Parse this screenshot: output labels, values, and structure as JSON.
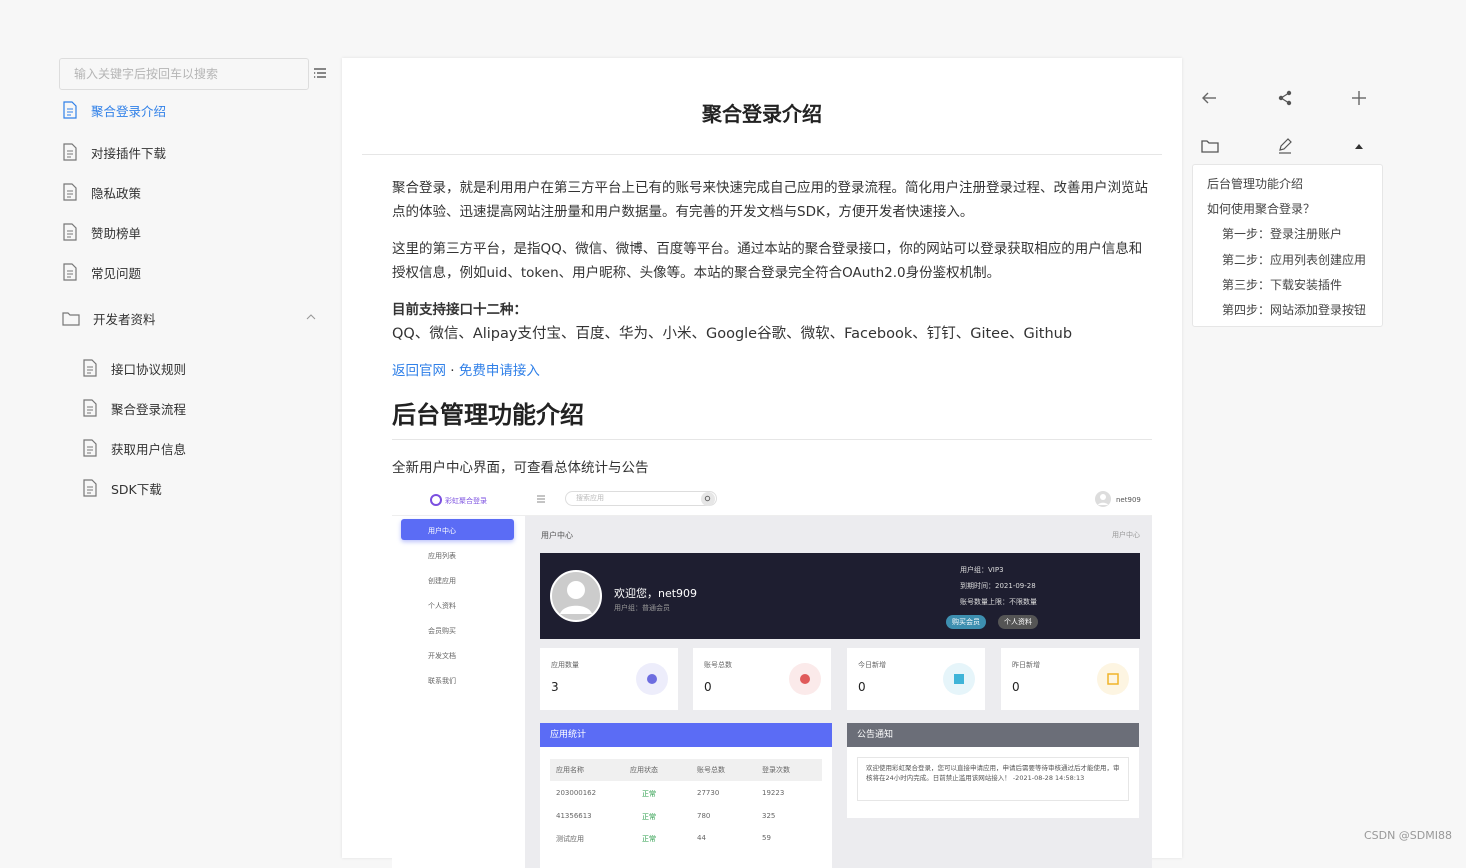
{
  "search": {
    "placeholder": "输入关键字后按回车以搜索"
  },
  "sidebar": {
    "items": [
      {
        "label": "聚合登录介绍"
      },
      {
        "label": "对接插件下载"
      },
      {
        "label": "隐私政策"
      },
      {
        "label": "赞助榜单"
      },
      {
        "label": "常见问题"
      }
    ],
    "folder": {
      "label": "开发者资料"
    },
    "sub_items": [
      {
        "label": "接口协议规则"
      },
      {
        "label": "聚合登录流程"
      },
      {
        "label": "获取用户信息"
      },
      {
        "label": "SDK下载"
      }
    ]
  },
  "doc": {
    "title": "聚合登录介绍",
    "p1": "聚合登录，就是利用用户在第三方平台上已有的账号来快速完成自己应用的登录流程。简化用户注册登录过程、改善用户浏览站点的体验、迅速提高网站注册量和用户数据量。有完善的开发文档与SDK，方便开发者快速接入。",
    "p2": "这里的第三方平台，是指QQ、微信、微博、百度等平台。通过本站的聚合登录接口，你的网站可以登录获取相应的用户信息和授权信息，例如uid、token、用户昵称、头像等。本站的聚合登录完全符合OAuth2.0身份鉴权机制。",
    "support_title": "目前支持接口十二种：",
    "support_list": "QQ、微信、Alipay支付宝、百度、华为、小米、Google谷歌、微软、Facebook、钉钉、Gitee、Github",
    "link_home": "返回官网",
    "link_sep": " · ",
    "link_apply": "免费申请接入",
    "h2": "后台管理功能介绍",
    "p3": "全新用户中心界面，可查看总体统计与公告"
  },
  "screenshot": {
    "brand": "彩虹聚合登录",
    "search_placeholder": "搜索应用",
    "username": "net909",
    "menu": [
      "用户中心",
      "应用列表",
      "创建应用",
      "个人资料",
      "会员购买",
      "开发文档",
      "联系我们"
    ],
    "breadcrumb_title": "用户中心",
    "breadcrumb_right": "用户中心",
    "welcome": "欢迎您，net909",
    "user_group_sub": "用户组：普通会员",
    "info": [
      "用户组：VIP3",
      "到期时间：2021-09-28",
      "账号数量上限：不限数量"
    ],
    "btn_buy": "购买会员",
    "btn_profile": "个人资料",
    "stats": [
      {
        "label": "应用数量",
        "value": "3",
        "color": "#6d6de0"
      },
      {
        "label": "账号总数",
        "value": "0",
        "color": "#e05a5a"
      },
      {
        "label": "今日新增",
        "value": "0",
        "color": "#3fb4d8"
      },
      {
        "label": "昨日新增",
        "value": "0",
        "color": "#f0b429"
      }
    ],
    "app_stats_title": "应用统计",
    "notice_title": "公告通知",
    "table_headers": [
      "应用名称",
      "应用状态",
      "账号总数",
      "登录次数"
    ],
    "table_rows": [
      [
        "203000162",
        "正常",
        "27730",
        "19223"
      ],
      [
        "41356613",
        "正常",
        "780",
        "325"
      ],
      [
        "测试应用",
        "正常",
        "44",
        "59"
      ]
    ],
    "notice_text": "欢迎使用彩虹聚合登录，您可以直接申请应用，申请后需要等待审核通过后才能使用，审核将在24小时内完成。日前禁止滥用该网站接入！ -2021-08-28 14:58:13"
  },
  "rail": {
    "back_icon": "arrow-left-icon",
    "share_icon": "share-icon",
    "add_icon": "plus-icon"
  },
  "outline": {
    "items": [
      {
        "label": "后台管理功能介绍"
      },
      {
        "label": "如何使用聚合登录？"
      },
      {
        "label": "第一步：登录注册账户"
      },
      {
        "label": "第二步：应用列表创建应用"
      },
      {
        "label": "第三步：下载安装插件"
      },
      {
        "label": "第四步：网站添加登录按钮"
      }
    ]
  },
  "credit": "CSDN @SDMI88",
  "colors": {
    "accent": "#3080e8",
    "banner": "#1e1e30",
    "menu_active": "#5b6cf5",
    "notice_header": "#6b6e78"
  }
}
